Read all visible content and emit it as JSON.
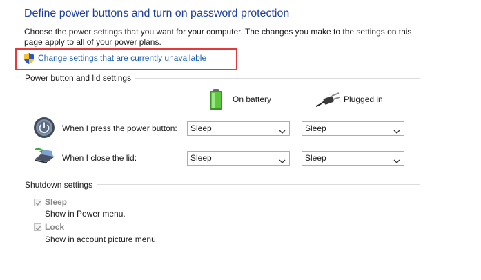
{
  "header": {
    "title": "Define power buttons and turn on password protection",
    "description": "Choose the power settings that you want for your computer. The changes you make to the settings on this page apply to all of your power plans.",
    "change_link": "Change settings that are currently unavailable",
    "highlight_color": "#e03c3c"
  },
  "power_lid": {
    "group_label": "Power button and lid settings",
    "columns": {
      "battery": {
        "label": "On battery",
        "icon": "battery-icon"
      },
      "plugged": {
        "label": "Plugged in",
        "icon": "power-plug-icon"
      }
    },
    "rows": {
      "power_button": {
        "label": "When I press the power button:",
        "icon": "power-button-icon",
        "battery": "Sleep",
        "plugged": "Sleep"
      },
      "lid": {
        "label": "When I close the lid:",
        "icon": "laptop-lid-icon",
        "battery": "Sleep",
        "plugged": "Sleep"
      }
    }
  },
  "shutdown": {
    "group_label": "Shutdown settings",
    "sleep": {
      "label": "Sleep",
      "description": "Show in Power menu.",
      "checked": true,
      "disabled": true
    },
    "lock": {
      "label": "Lock",
      "description": "Show in account picture menu.",
      "checked": true,
      "disabled": true
    }
  }
}
